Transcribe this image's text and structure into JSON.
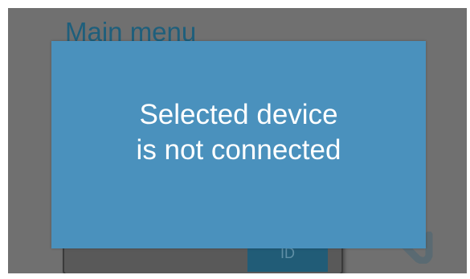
{
  "screen": {
    "title": "Main menu"
  },
  "device_panel": {
    "id_button_label": "ID"
  },
  "modal": {
    "message_line1": "Selected device",
    "message_line2": "is not connected"
  },
  "colors": {
    "overlay_gray": "#707070",
    "modal_blue": "#4a91bd",
    "title_blue": "#1e5f7c",
    "button_dark_blue": "#215c77"
  },
  "icons": [
    "back-arrow-icon"
  ]
}
